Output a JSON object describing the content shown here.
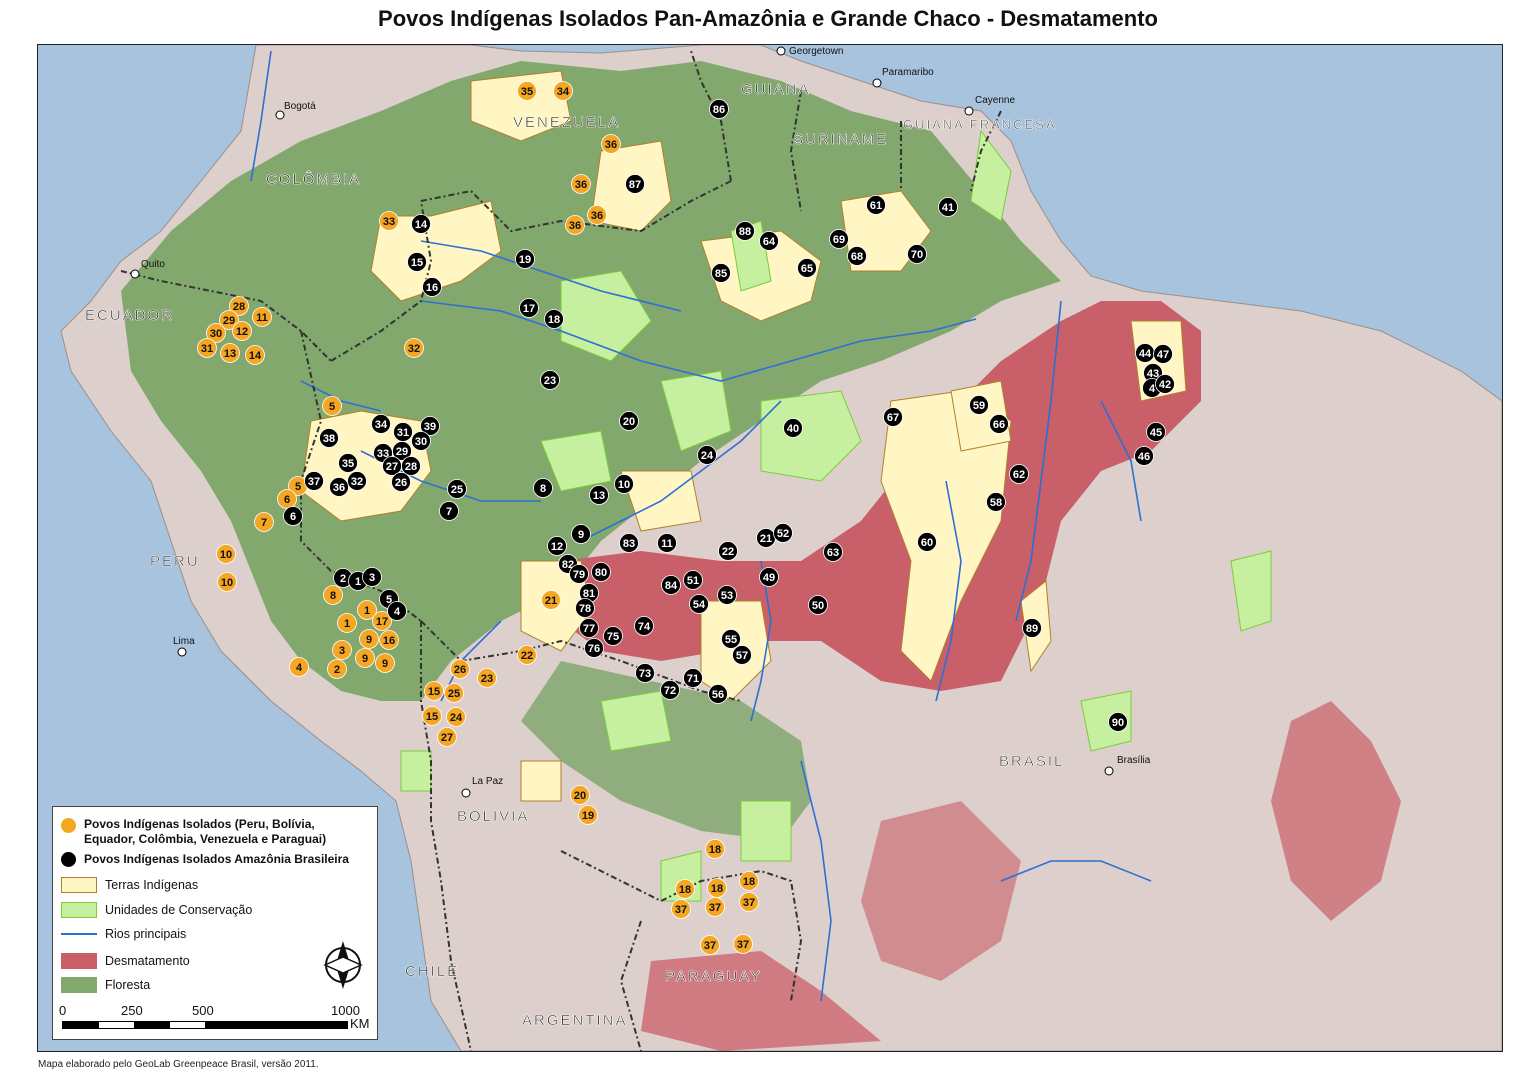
{
  "title": "Povos Indígenas Isolados Pan-Amazônia e Grande Chaco - Desmatamento",
  "credit": "Mapa elaborado pelo GeoLab Greenpeace Brasil, versão 2011.",
  "colors": {
    "ocean": "#a8c3dd",
    "land": "#ddd0cc",
    "forest": "#82a86e",
    "conservation": "#c6f0a0",
    "conservation_border": "#7acc3a",
    "indigenous": "#fff6c4",
    "indigenous_border": "#b0802a",
    "deforestation": "#c95f68",
    "rivers": "#2e6fd4",
    "orange_marker": "#f5a623",
    "black_marker": "#000000"
  },
  "legend": {
    "orange_label": "Povos Indígenas Isolados (Peru, Bolívia, Equador, Colômbia, Venezuela e Paraguai)",
    "black_label": "Povos Indígenas Isolados Amazônia Brasileira",
    "indigenous_label": "Terras Indígenas",
    "conservation_label": "Unidades de Conservação",
    "rivers_label": "Rios principais",
    "deforestation_label": "Desmatamento",
    "forest_label": "Floresta",
    "north_arrow": "north-arrow-icon"
  },
  "scale": {
    "ticks": [
      "0",
      "250",
      "500",
      "1000"
    ],
    "unit": "KM"
  },
  "countries": [
    "COLÔMBIA",
    "VENEZUELA",
    "GUIANA",
    "SURINAME",
    "GUIANA FRANCESA",
    "ECUADOR",
    "PERU",
    "BOLIVIA",
    "BRASIL",
    "CHILE",
    "PARAGUAY",
    "ARGENTINA"
  ],
  "cities": [
    "Georgetown",
    "Paramaribo",
    "Cayenne",
    "Bogotá",
    "Quito",
    "Lima",
    "La Paz",
    "Brasília"
  ],
  "markers_orange": [
    "35",
    "34",
    "36",
    "36",
    "36",
    "36",
    "33",
    "28",
    "29",
    "11",
    "30",
    "12",
    "31",
    "13",
    "14",
    "32",
    "5",
    "5",
    "6",
    "7",
    "10",
    "10",
    "8",
    "1",
    "17",
    "1",
    "9",
    "16",
    "3",
    "9",
    "9",
    "2",
    "4",
    "21",
    "22",
    "26",
    "23",
    "15",
    "25",
    "15",
    "24",
    "27",
    "20",
    "19",
    "18",
    "18",
    "18",
    "18",
    "37",
    "37",
    "37",
    "37",
    "37"
  ],
  "markers_black": [
    "86",
    "87",
    "14",
    "15",
    "16",
    "19",
    "17",
    "18",
    "23",
    "61",
    "41",
    "88",
    "64",
    "69",
    "68",
    "70",
    "65",
    "85",
    "20",
    "34",
    "39",
    "31",
    "30",
    "38",
    "33",
    "29",
    "27",
    "28",
    "35",
    "37",
    "36",
    "32",
    "26",
    "25",
    "8",
    "13",
    "10",
    "7",
    "6",
    "9",
    "12",
    "83",
    "11",
    "22",
    "21",
    "52",
    "63",
    "40",
    "24",
    "67",
    "59",
    "66",
    "62",
    "58",
    "60",
    "2",
    "1",
    "3",
    "5",
    "4",
    "82",
    "79",
    "80",
    "81",
    "78",
    "84",
    "51",
    "54",
    "53",
    "49",
    "50",
    "77",
    "75",
    "74",
    "76",
    "55",
    "57",
    "73",
    "71",
    "72",
    "56",
    "89",
    "44",
    "47",
    "43",
    "4",
    "42",
    "45",
    "46",
    "90"
  ]
}
